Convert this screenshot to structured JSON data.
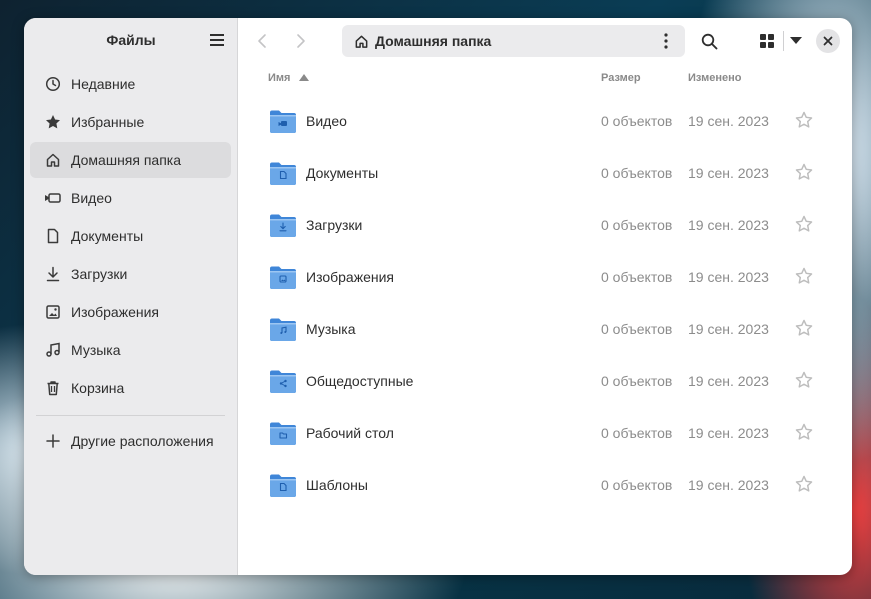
{
  "window": {
    "app_title": "Файлы"
  },
  "sidebar": {
    "items": [
      {
        "label": "Недавние",
        "icon": "clock-icon",
        "active": false
      },
      {
        "label": "Избранные",
        "icon": "star-icon",
        "active": false
      },
      {
        "label": "Домашняя папка",
        "icon": "home-icon",
        "active": true
      },
      {
        "label": "Видео",
        "icon": "camera-icon",
        "active": false
      },
      {
        "label": "Документы",
        "icon": "document-icon",
        "active": false
      },
      {
        "label": "Загрузки",
        "icon": "download-icon",
        "active": false
      },
      {
        "label": "Изображения",
        "icon": "image-icon",
        "active": false
      },
      {
        "label": "Музыка",
        "icon": "music-icon",
        "active": false
      },
      {
        "label": "Корзина",
        "icon": "trash-icon",
        "active": false
      }
    ],
    "other_locations": "Другие расположения"
  },
  "toolbar": {
    "path_label": "Домашняя папка"
  },
  "columns": {
    "name": "Имя",
    "size": "Размер",
    "modified": "Изменено"
  },
  "files": [
    {
      "name": "Видео",
      "size": "0 объектов",
      "modified": "19 сен. 2023",
      "emblem": "camera-icon"
    },
    {
      "name": "Документы",
      "size": "0 объектов",
      "modified": "19 сен. 2023",
      "emblem": "document-icon"
    },
    {
      "name": "Загрузки",
      "size": "0 объектов",
      "modified": "19 сен. 2023",
      "emblem": "download-icon"
    },
    {
      "name": "Изображения",
      "size": "0 объектов",
      "modified": "19 сен. 2023",
      "emblem": "image-icon"
    },
    {
      "name": "Музыка",
      "size": "0 объектов",
      "modified": "19 сен. 2023",
      "emblem": "music-icon"
    },
    {
      "name": "Общедоступные",
      "size": "0 объектов",
      "modified": "19 сен. 2023",
      "emblem": "share-icon"
    },
    {
      "name": "Рабочий стол",
      "size": "0 объектов",
      "modified": "19 сен. 2023",
      "emblem": "folder-icon"
    },
    {
      "name": "Шаблоны",
      "size": "0 объектов",
      "modified": "19 сен. 2023",
      "emblem": "document-icon"
    }
  ],
  "colors": {
    "folder_body": "#6aa7e8",
    "folder_back": "#3f86d8",
    "sidebar_bg": "#ebebed",
    "active_item_bg": "#dcdcde"
  }
}
